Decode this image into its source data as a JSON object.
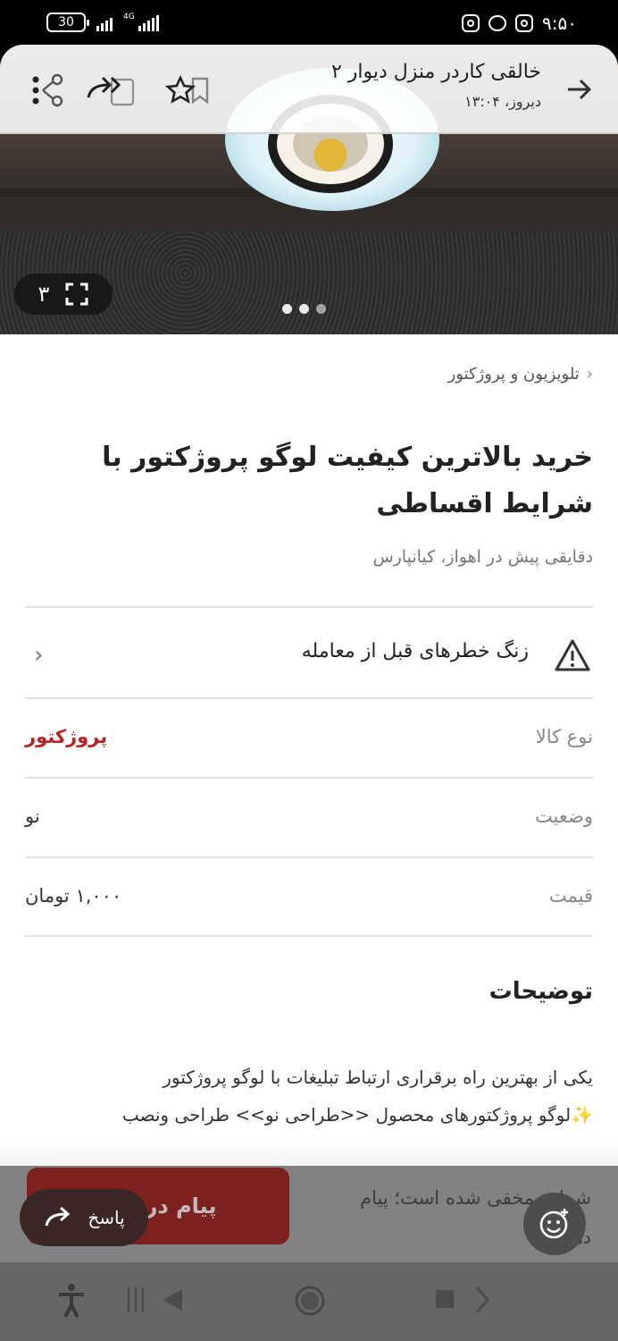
{
  "status_bar": {
    "battery": "30",
    "network": "4G",
    "time": "۹:۵۰",
    "icons": [
      "battery-icon",
      "signal-icon",
      "instagram-icon",
      "chat-icon",
      "instagram-icon"
    ]
  },
  "header": {
    "title": "خالقی کاردر منزل دیوار ۲",
    "subtitle": "دیروز، ۱۳:۰۴",
    "icons": [
      "back-arrow-icon",
      "bookmark-icon",
      "star-icon",
      "forward-icon",
      "share-icon",
      "more-icon"
    ]
  },
  "gallery": {
    "count": "۳",
    "dots": 3,
    "active_dot": 1
  },
  "listing": {
    "breadcrumb": "تلویزیون و پروژکتور",
    "title": "خرید بالاترین کیفیت لوگو پروژکتور با شرایط اقساطی",
    "meta": "دقایقی پیش در اهواز، کیانپارس",
    "warning": "زنگ خطرهای قبل از معامله",
    "attributes": [
      {
        "key": "نوع کالا",
        "value": "پروژکتور",
        "highlight": true
      },
      {
        "key": "وضعیت",
        "value": "نو",
        "highlight": false
      },
      {
        "key": "قیمت",
        "value": "۱,۰۰۰ تومان",
        "highlight": false
      }
    ],
    "description_title": "توضیحات",
    "description_lines": [
      "یکی از بهترین راه برقراری ارتباط تبلیغات با لوگو پروژکتور",
      "✨لوگو پروژکتورهای محصول <<طراحی نو>> طراحی ونصب"
    ]
  },
  "bottom": {
    "hidden_number_text": "شماره مخفی شده است؛ پیام",
    "hidden_number_text2": "دهید.",
    "cta_label": "پیام در چت",
    "reply_label": "پاسخ"
  },
  "colors": {
    "accent_red": "#b52525",
    "cta_bg": "#7c2020"
  }
}
